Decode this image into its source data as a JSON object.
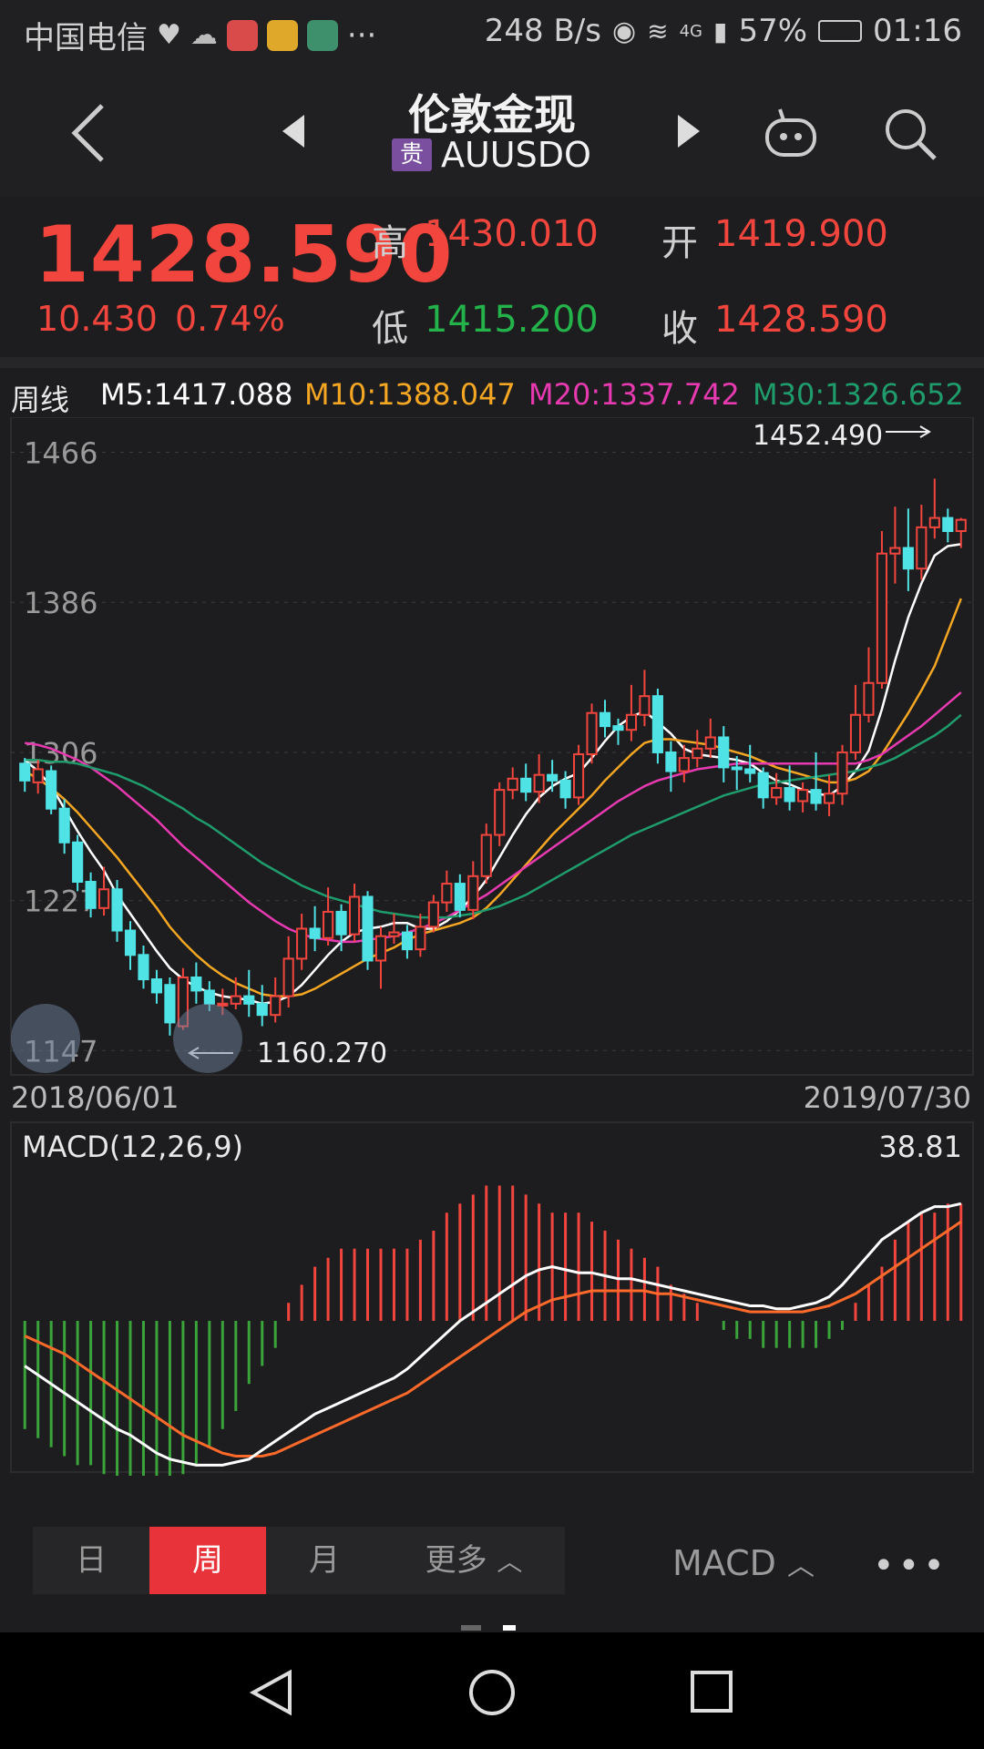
{
  "status_bar": {
    "carrier": "中国电信",
    "net_speed": "248 B/s",
    "network": "4G",
    "battery": "57%",
    "time": "01:16"
  },
  "header": {
    "title": "伦敦金现",
    "badge": "贵",
    "code": "AUUSDO"
  },
  "quote": {
    "price": "1428.590",
    "change": "10.430",
    "change_pct": "0.74%",
    "high_label": "高",
    "high": "1430.010",
    "low_label": "低",
    "low": "1415.200",
    "open_label": "开",
    "open": "1419.900",
    "close_label": "收",
    "close": "1428.590"
  },
  "ma_legend": {
    "period": "周线",
    "m5": "M5:1417.088",
    "m10": "M10:1388.047",
    "m20": "M20:1337.742",
    "m30": "M30:1326.652"
  },
  "colors": {
    "up": "#f2453d",
    "down": "#4fe3e6",
    "m5": "#ffffff",
    "m10": "#f5a623",
    "m20": "#e83ab0",
    "m30": "#1f9c6c",
    "accent": "#e8333a",
    "green": "#24b34a"
  },
  "chart_data": {
    "type": "candlestick",
    "y_ticks": [
      "1466",
      "1386",
      "1306",
      "1227",
      "1147"
    ],
    "ylim": [
      1135,
      1475
    ],
    "max_label": "1452.490",
    "min_label": "1160.270",
    "start_date": "2018/06/01",
    "end_date": "2019/07/30",
    "candles": [
      [
        1300,
        1291,
        1303,
        1285
      ],
      [
        1290,
        1297,
        1302,
        1284
      ],
      [
        1296,
        1276,
        1299,
        1273
      ],
      [
        1276,
        1258,
        1281,
        1252
      ],
      [
        1258,
        1237,
        1262,
        1232
      ],
      [
        1237,
        1223,
        1242,
        1218
      ],
      [
        1223,
        1233,
        1245,
        1219
      ],
      [
        1233,
        1211,
        1238,
        1205
      ],
      [
        1211,
        1198,
        1216,
        1190
      ],
      [
        1198,
        1185,
        1203,
        1180
      ],
      [
        1185,
        1178,
        1190,
        1172
      ],
      [
        1182,
        1162,
        1186,
        1155
      ],
      [
        1160,
        1186,
        1191,
        1158
      ],
      [
        1186,
        1179,
        1194,
        1172
      ],
      [
        1179,
        1172,
        1184,
        1168
      ],
      [
        1172,
        1172,
        1180,
        1166
      ],
      [
        1172,
        1176,
        1186,
        1169
      ],
      [
        1176,
        1172,
        1190,
        1165
      ],
      [
        1172,
        1166,
        1182,
        1160
      ],
      [
        1166,
        1176,
        1186,
        1162
      ],
      [
        1176,
        1196,
        1208,
        1170
      ],
      [
        1196,
        1212,
        1220,
        1190
      ],
      [
        1212,
        1207,
        1224,
        1200
      ],
      [
        1207,
        1221,
        1234,
        1203
      ],
      [
        1221,
        1209,
        1225,
        1200
      ],
      [
        1209,
        1229,
        1236,
        1205
      ],
      [
        1229,
        1195,
        1232,
        1190
      ],
      [
        1195,
        1208,
        1213,
        1180
      ],
      [
        1208,
        1210,
        1220,
        1204
      ],
      [
        1210,
        1201,
        1214,
        1196
      ],
      [
        1201,
        1213,
        1220,
        1197
      ],
      [
        1213,
        1226,
        1230,
        1210
      ],
      [
        1226,
        1236,
        1243,
        1221
      ],
      [
        1236,
        1222,
        1241,
        1218
      ],
      [
        1222,
        1240,
        1248,
        1217
      ],
      [
        1240,
        1262,
        1268,
        1236
      ],
      [
        1262,
        1286,
        1290,
        1256
      ],
      [
        1286,
        1292,
        1298,
        1281
      ],
      [
        1292,
        1285,
        1300,
        1280
      ],
      [
        1285,
        1294,
        1305,
        1279
      ],
      [
        1294,
        1291,
        1302,
        1285
      ],
      [
        1291,
        1282,
        1296,
        1276
      ],
      [
        1282,
        1305,
        1310,
        1278
      ],
      [
        1305,
        1327,
        1332,
        1300
      ],
      [
        1327,
        1320,
        1334,
        1314
      ],
      [
        1320,
        1318,
        1324,
        1310
      ],
      [
        1318,
        1326,
        1342,
        1312
      ],
      [
        1326,
        1336,
        1350,
        1320
      ],
      [
        1336,
        1306,
        1340,
        1300
      ],
      [
        1306,
        1296,
        1312,
        1285
      ],
      [
        1296,
        1303,
        1310,
        1290
      ],
      [
        1303,
        1308,
        1318,
        1298
      ],
      [
        1308,
        1314,
        1324,
        1303
      ],
      [
        1314,
        1298,
        1320,
        1290
      ],
      [
        1298,
        1297,
        1304,
        1286
      ],
      [
        1297,
        1295,
        1310,
        1290
      ],
      [
        1295,
        1282,
        1298,
        1276
      ],
      [
        1282,
        1287,
        1295,
        1278
      ],
      [
        1287,
        1280,
        1299,
        1275
      ],
      [
        1280,
        1286,
        1290,
        1274
      ],
      [
        1286,
        1279,
        1306,
        1275
      ],
      [
        1279,
        1284,
        1294,
        1272
      ],
      [
        1284,
        1306,
        1310,
        1278
      ],
      [
        1306,
        1326,
        1342,
        1302
      ],
      [
        1326,
        1343,
        1362,
        1322
      ],
      [
        1343,
        1412,
        1424,
        1340
      ],
      [
        1412,
        1415,
        1437,
        1396
      ],
      [
        1415,
        1404,
        1436,
        1392
      ],
      [
        1404,
        1426,
        1438,
        1398
      ],
      [
        1426,
        1431,
        1452,
        1420
      ],
      [
        1431,
        1424,
        1436,
        1418
      ],
      [
        1424,
        1430,
        1431,
        1415
      ]
    ],
    "ma": {
      "m5": [
        1302,
        1296,
        1288,
        1276,
        1264,
        1253,
        1243,
        1230,
        1220,
        1210,
        1200,
        1191,
        1185,
        1181,
        1178,
        1176,
        1175,
        1174,
        1172,
        1173,
        1176,
        1182,
        1190,
        1198,
        1205,
        1210,
        1212,
        1213,
        1215,
        1215,
        1212,
        1212,
        1216,
        1222,
        1229,
        1238,
        1250,
        1262,
        1273,
        1282,
        1288,
        1292,
        1295,
        1303,
        1312,
        1320,
        1325,
        1328,
        1322,
        1316,
        1308,
        1305,
        1304,
        1303,
        1302,
        1300,
        1295,
        1291,
        1289,
        1286,
        1284,
        1283,
        1288,
        1296,
        1307,
        1329,
        1355,
        1378,
        1396,
        1411,
        1416,
        1417
      ],
      "m10": [
        1296,
        1292,
        1287,
        1281,
        1274,
        1266,
        1258,
        1250,
        1241,
        1232,
        1223,
        1213,
        1205,
        1198,
        1192,
        1187,
        1183,
        1180,
        1177,
        1176,
        1176,
        1177,
        1180,
        1184,
        1188,
        1192,
        1196,
        1199,
        1202,
        1206,
        1209,
        1211,
        1213,
        1215,
        1218,
        1223,
        1230,
        1238,
        1246,
        1254,
        1262,
        1269,
        1276,
        1283,
        1291,
        1298,
        1305,
        1311,
        1313,
        1313,
        1312,
        1311,
        1310,
        1308,
        1306,
        1304,
        1301,
        1298,
        1296,
        1294,
        1292,
        1290,
        1290,
        1292,
        1296,
        1305,
        1316,
        1327,
        1339,
        1352,
        1370,
        1388
      ],
      "m20": [
        1311,
        1310,
        1308,
        1305,
        1302,
        1298,
        1293,
        1288,
        1282,
        1276,
        1270,
        1263,
        1256,
        1250,
        1244,
        1238,
        1232,
        1226,
        1221,
        1216,
        1212,
        1209,
        1207,
        1206,
        1205,
        1205,
        1206,
        1207,
        1208,
        1210,
        1212,
        1215,
        1218,
        1222,
        1226,
        1230,
        1235,
        1240,
        1245,
        1250,
        1255,
        1260,
        1265,
        1270,
        1275,
        1280,
        1284,
        1288,
        1291,
        1293,
        1295,
        1297,
        1298,
        1299,
        1300,
        1300,
        1300,
        1300,
        1300,
        1300,
        1300,
        1300,
        1300,
        1300,
        1302,
        1305,
        1310,
        1315,
        1320,
        1326,
        1332,
        1338
      ],
      "m30": [
        1302,
        1302,
        1301,
        1301,
        1300,
        1298,
        1296,
        1294,
        1291,
        1288,
        1284,
        1280,
        1276,
        1271,
        1267,
        1262,
        1257,
        1252,
        1247,
        1243,
        1239,
        1235,
        1232,
        1229,
        1227,
        1225,
        1223,
        1221,
        1220,
        1219,
        1218,
        1218,
        1218,
        1219,
        1220,
        1222,
        1224,
        1227,
        1230,
        1234,
        1238,
        1242,
        1246,
        1250,
        1254,
        1258,
        1262,
        1265,
        1268,
        1271,
        1274,
        1277,
        1280,
        1283,
        1285,
        1287,
        1289,
        1290,
        1291,
        1292,
        1293,
        1294,
        1295,
        1296,
        1298,
        1300,
        1303,
        1307,
        1311,
        1315,
        1320,
        1326
      ]
    }
  },
  "macd": {
    "label": "MACD(12,26,9)",
    "value": "38.81",
    "hist": [
      -12,
      -13,
      -14,
      -15,
      -16,
      -16,
      -17,
      -18,
      -18,
      -18,
      -19,
      -18,
      -17,
      -16,
      -14,
      -12,
      -10,
      -7,
      -5,
      -3,
      2,
      4,
      6,
      7,
      8,
      8,
      8,
      8,
      8,
      8,
      9,
      10,
      12,
      13,
      14,
      15,
      15,
      15,
      14,
      13,
      12,
      12,
      12,
      11,
      10,
      9,
      8,
      7,
      6,
      4,
      3,
      2,
      0,
      -1,
      -2,
      -2,
      -3,
      -3,
      -3,
      -3,
      -3,
      -2,
      -1,
      2,
      4,
      6,
      9,
      11,
      12,
      12,
      13,
      13
    ],
    "dif": [
      -15,
      -18,
      -21,
      -24,
      -27,
      -30,
      -33,
      -36,
      -38,
      -41,
      -44,
      -46,
      -47,
      -48,
      -48,
      -48,
      -47,
      -46,
      -43,
      -40,
      -37,
      -34,
      -31,
      -29,
      -27,
      -25,
      -23,
      -21,
      -19,
      -16,
      -12,
      -8,
      -4,
      0,
      3,
      6,
      9,
      12,
      15,
      17,
      18,
      17,
      16,
      16,
      15,
      14,
      14,
      13,
      12,
      11,
      10,
      9,
      8,
      7,
      6,
      5,
      5,
      4,
      4,
      5,
      6,
      8,
      12,
      17,
      22,
      27,
      30,
      33,
      36,
      38,
      38,
      39
    ],
    "dea": [
      -5,
      -7,
      -9,
      -11,
      -14,
      -17,
      -20,
      -23,
      -26,
      -29,
      -32,
      -35,
      -38,
      -40,
      -42,
      -44,
      -45,
      -45,
      -45,
      -44,
      -42,
      -40,
      -38,
      -36,
      -34,
      -32,
      -30,
      -28,
      -26,
      -24,
      -21,
      -18,
      -15,
      -12,
      -9,
      -6,
      -3,
      0,
      3,
      5,
      7,
      8,
      9,
      10,
      10,
      10,
      10,
      10,
      9,
      9,
      8,
      7,
      6,
      5,
      4,
      3,
      3,
      3,
      3,
      3,
      4,
      5,
      7,
      9,
      12,
      15,
      18,
      21,
      24,
      27,
      30,
      33
    ]
  },
  "toolbar": {
    "tabs": [
      "日",
      "周",
      "月",
      "更多"
    ],
    "active_tab": "周",
    "indicator": "MACD",
    "more": "•••"
  }
}
